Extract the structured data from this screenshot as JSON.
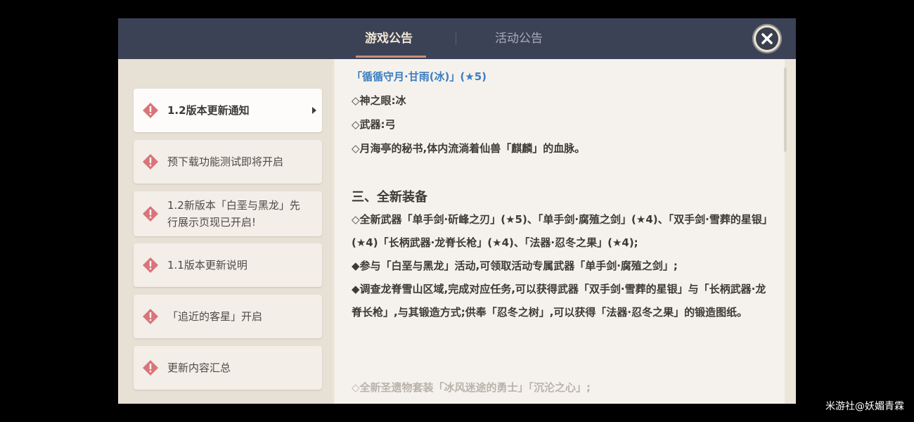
{
  "tabs": {
    "game": "游戏公告",
    "event": "活动公告"
  },
  "sidebar": {
    "items": [
      {
        "label": "1.2版本更新通知"
      },
      {
        "label": "预下载功能测试即将开启"
      },
      {
        "label": "1.2新版本「白垩与黑龙」先行展示页现已开启!"
      },
      {
        "label": "1.1版本更新说明"
      },
      {
        "label": "「追近的客星」开启"
      },
      {
        "label": "更新内容汇总"
      }
    ]
  },
  "content": {
    "char_title": "「循循守月·甘雨(冰)」(★5)",
    "vision": "◇神之眼:冰",
    "weapon": "◇武器:弓",
    "desc": "◇月海亭的秘书,体内流淌着仙兽「麒麟」的血脉。",
    "section_heading": "三、全新装备",
    "para1": "◇全新武器「单手剑·斫峰之刃」(★5)、「单手剑·腐殖之剑」(★4)、「双手剑·雪葬的星银」(★4)「长柄武器·龙脊长枪」(★4)、「法器·忍冬之果」(★4);",
    "para2": "◆参与「白垩与黑龙」活动,可领取活动专属武器「单手剑·腐殖之剑」;",
    "para3": "◆调查龙脊雪山区域,完成对应任务,可以获得武器「双手剑·雪葬的星银」与「长柄武器·龙脊长枪」,与其锻造方式;供奉「忍冬之树」,可以获得「法器·忍冬之果」的锻造图纸。",
    "faded_line": "◇全新圣遗物套装「冰风迷途的勇士」「沉沦之心」;"
  },
  "watermark": "米游社@妖媚青霖",
  "colors": {
    "header": "#3b4256",
    "accent_blue": "#3d7ec1",
    "warn_red": "#d8757a"
  }
}
